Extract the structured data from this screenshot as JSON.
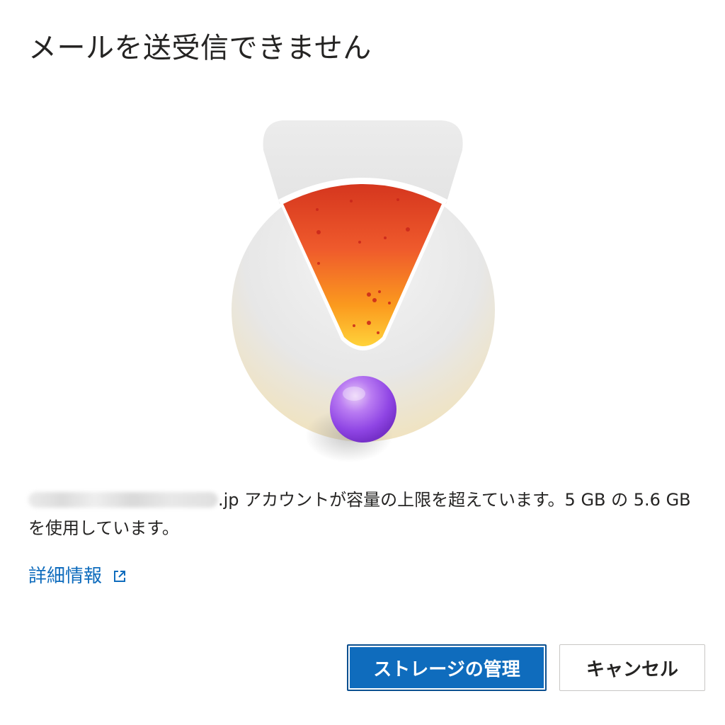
{
  "dialog": {
    "title": "メールを送受信できません",
    "message_after_email": ".jp アカウントが容量の上限を超えています。5 GB の 5.6 GB を使用しています。",
    "more_info_label": "詳細情報",
    "storage_used_gb": 5.6,
    "storage_limit_gb": 5,
    "primary_button_label": "ストレージの管理",
    "secondary_button_label": "キャンセル",
    "icons": {
      "illustration": "warning-exclamation-illustration",
      "more_info": "external-link-icon"
    },
    "colors": {
      "accent": "#0f6cbd",
      "warning_top": "#e8442b",
      "warning_bottom": "#ffc21a",
      "dot": "#9a5bf0"
    }
  }
}
